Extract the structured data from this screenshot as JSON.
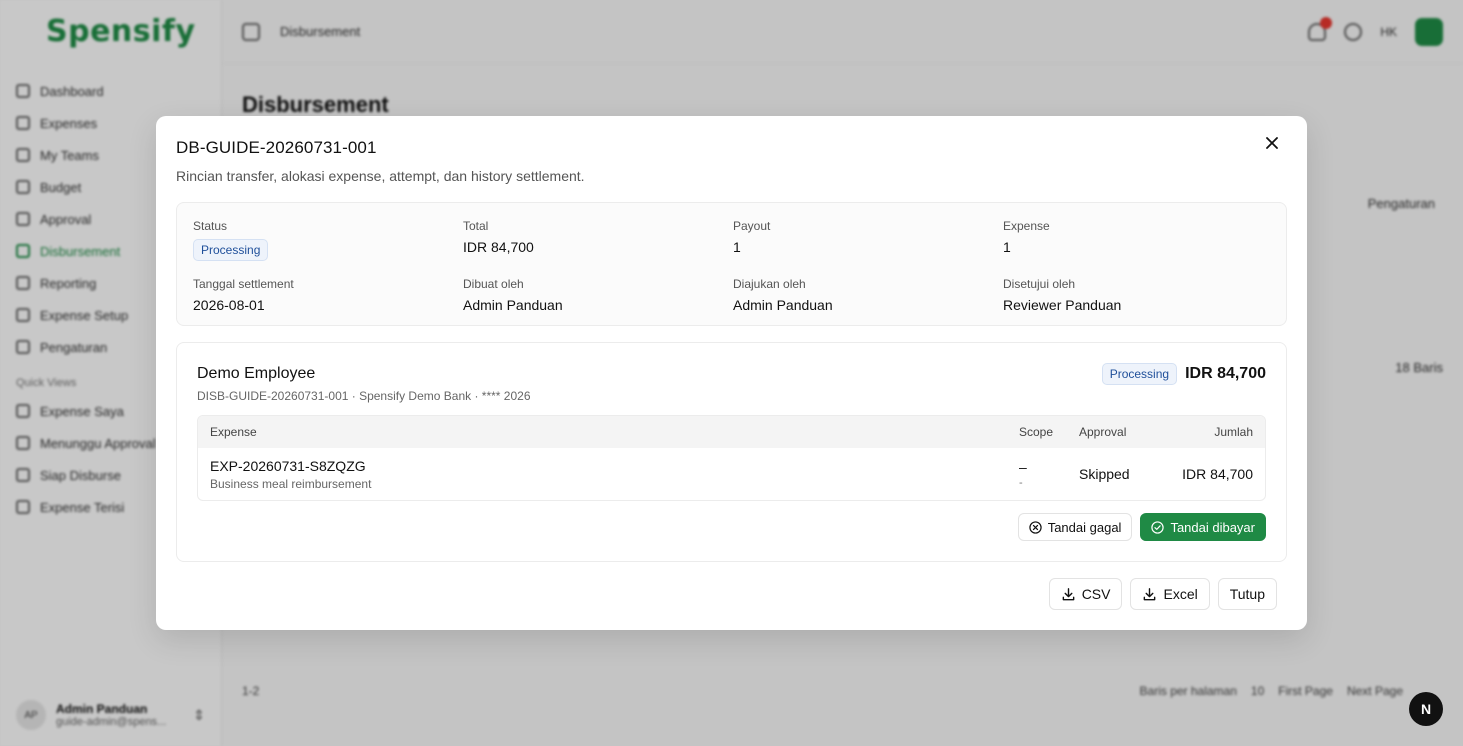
{
  "app": {
    "logo": "Spensify",
    "breadcrumb": "Disbursement",
    "page_title": "Disbursement",
    "top_initials": "HK",
    "bg_settings": "Pengaturan",
    "bg_count": "18 Baris",
    "bg_page": "1-2",
    "bg_rows_per_page": "Baris per halaman",
    "bg_rows_value": "10",
    "bg_first_page": "First Page",
    "bg_next_page": "Next Page",
    "next_badge": "N"
  },
  "sidebar": {
    "items": [
      {
        "label": "Dashboard"
      },
      {
        "label": "Expenses"
      },
      {
        "label": "My Teams"
      },
      {
        "label": "Budget"
      },
      {
        "label": "Approval"
      },
      {
        "label": "Disbursement"
      },
      {
        "label": "Reporting"
      },
      {
        "label": "Expense Setup"
      },
      {
        "label": "Pengaturan"
      }
    ],
    "group_label": "Quick Views",
    "quick_items": [
      {
        "label": "Expense Saya"
      },
      {
        "label": "Menunggu Approval"
      },
      {
        "label": "Siap Disburse"
      },
      {
        "label": "Expense Terisi"
      }
    ],
    "user": {
      "initials": "AP",
      "name": "Admin Panduan",
      "email": "guide-admin@spens..."
    }
  },
  "dialog": {
    "title": "DB-GUIDE-20260731-001",
    "subtitle": "Rincian transfer, alokasi expense, attempt, dan history settlement.",
    "summary": {
      "status_label": "Status",
      "status_value": "Processing",
      "total_label": "Total",
      "total_value": "IDR 84,700",
      "payout_label": "Payout",
      "payout_value": "1",
      "expense_label": "Expense",
      "expense_value": "1",
      "settlement_label": "Tanggal settlement",
      "settlement_value": "2026-08-01",
      "created_label": "Dibuat oleh",
      "created_value": "Admin Panduan",
      "submitted_label": "Diajukan oleh",
      "submitted_value": "Admin Panduan",
      "approved_label": "Disetujui oleh",
      "approved_value": "Reviewer Panduan"
    },
    "payout": {
      "name": "Demo Employee",
      "meta": "DISB-GUIDE-20260731-001 · Spensify Demo Bank · **** 2026",
      "status": "Processing",
      "amount": "IDR 84,700",
      "table": {
        "headers": {
          "expense": "Expense",
          "scope": "Scope",
          "approval": "Approval",
          "amount": "Jumlah"
        },
        "row": {
          "id": "EXP-20260731-S8ZQZG",
          "desc": "Business meal reimbursement",
          "scope_main": "–",
          "scope_sub": "-",
          "approval": "Skipped",
          "amount": "IDR 84,700"
        }
      },
      "mark_failed": "Tandai gagal",
      "mark_paid": "Tandai dibayar"
    },
    "actions": {
      "csv": "CSV",
      "excel": "Excel",
      "close": "Tutup"
    }
  }
}
